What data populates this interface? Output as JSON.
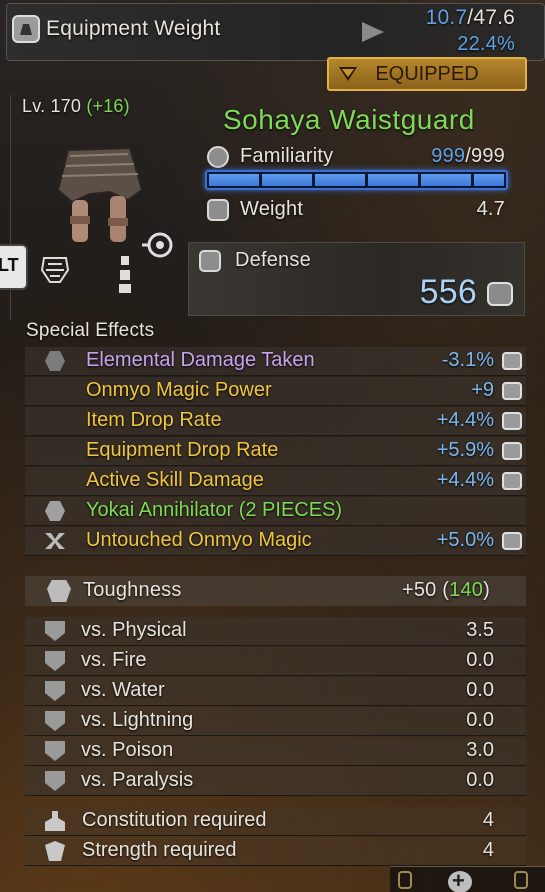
{
  "header": {
    "equipment_weight_label": "Equipment Weight",
    "current_weight": "10.7",
    "max_weight": "/47.6",
    "weight_percent": "22.4%"
  },
  "equipped_badge": "EQUIPPED",
  "item": {
    "level": "Lv. 170",
    "level_bonus": "(+16)",
    "name": "Sohaya Waistguard",
    "familiarity_label": "Familiarity",
    "familiarity_value": "999",
    "familiarity_max": "/999",
    "familiarity_fraction": 1.0,
    "weight_label": "Weight",
    "weight_value": "4.7",
    "defense_label": "Defense",
    "defense_value": "556",
    "side_tab": "LT"
  },
  "special_effects": {
    "title": "Special Effects",
    "items": [
      {
        "label": "Elemental Damage Taken",
        "value": "-3.1%",
        "label_color": "#c9a3f0",
        "value_color": "#7bb6f0",
        "icon": "hex-icon"
      },
      {
        "label": "Onmyo Magic Power",
        "value": "+9",
        "label_color": "#f0c640",
        "value_color": "#7bb6f0",
        "icon": ""
      },
      {
        "label": "Item Drop Rate",
        "value": "+4.4%",
        "label_color": "#f0c640",
        "value_color": "#7bb6f0",
        "icon": ""
      },
      {
        "label": "Equipment Drop Rate",
        "value": "+5.9%",
        "label_color": "#f0c640",
        "value_color": "#7bb6f0",
        "icon": ""
      },
      {
        "label": "Active Skill Damage",
        "value": "+4.4%",
        "label_color": "#f0c640",
        "value_color": "#7bb6f0",
        "icon": ""
      },
      {
        "label": "Yokai Annihilator (2 PIECES)",
        "value": "",
        "label_color": "#7ed957",
        "value_color": "#7bb6f0",
        "icon": "set-icon"
      },
      {
        "label": "Untouched Onmyo Magic",
        "value": "+5.0%",
        "label_color": "#f0c640",
        "value_color": "#7bb6f0",
        "icon": "bind-icon"
      }
    ]
  },
  "toughness": {
    "label": "Toughness",
    "value": "+50",
    "total": "140"
  },
  "resistances": [
    {
      "label": "vs. Physical",
      "value": "3.5",
      "icon": "physical-shield-icon"
    },
    {
      "label": "vs. Fire",
      "value": "0.0",
      "icon": "fire-shield-icon"
    },
    {
      "label": "vs. Water",
      "value": "0.0",
      "icon": "water-shield-icon"
    },
    {
      "label": "vs. Lightning",
      "value": "0.0",
      "icon": "lightning-shield-icon"
    },
    {
      "label": "vs. Poison",
      "value": "3.0",
      "icon": "poison-shield-icon"
    },
    {
      "label": "vs. Paralysis",
      "value": "0.0",
      "icon": "paralysis-shield-icon"
    }
  ],
  "requirements": [
    {
      "label": "Constitution required",
      "value": "4",
      "icon": "constitution-icon"
    },
    {
      "label": "Strength required",
      "value": "4",
      "icon": "strength-icon"
    }
  ],
  "colors": {
    "accent_gold": "#e0b24a",
    "accent_blue": "#5fa3e6",
    "name_green": "#7ed957"
  }
}
